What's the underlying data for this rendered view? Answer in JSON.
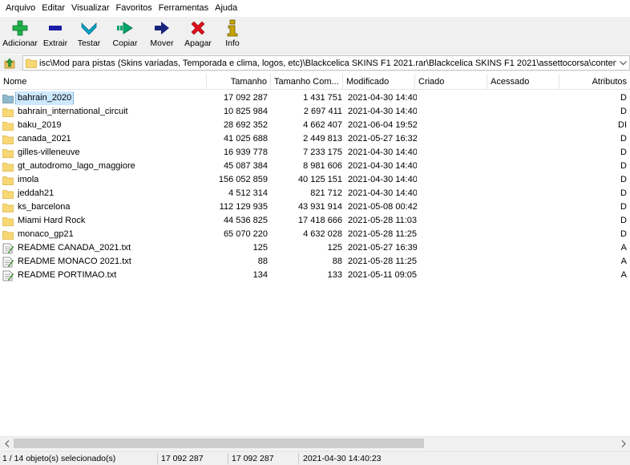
{
  "menu": [
    "Arquivo",
    "Editar",
    "Visualizar",
    "Favoritos",
    "Ferramentas",
    "Ajuda"
  ],
  "toolbar": [
    {
      "key": "add",
      "label": "Adicionar",
      "icon": "plus-icon",
      "color": "#22b14c"
    },
    {
      "key": "extract",
      "label": "Extrair",
      "icon": "minus-icon",
      "color": "#1a1aa6"
    },
    {
      "key": "test",
      "label": "Testar",
      "icon": "check-arrow-icon",
      "color": "#00a2c7"
    },
    {
      "key": "copy",
      "label": "Copiar",
      "icon": "double-arrow-icon",
      "color": "#00a86b"
    },
    {
      "key": "move",
      "label": "Mover",
      "icon": "arrow-right-icon",
      "color": "#1a237e"
    },
    {
      "key": "delete",
      "label": "Apagar",
      "icon": "x-icon",
      "color": "#e0101c"
    },
    {
      "key": "info",
      "label": "Info",
      "icon": "info-icon",
      "color": "#c8a400"
    }
  ],
  "address": {
    "path": "isc\\Mod para pistas (Skins variadas, Temporada e clima, logos, etc)\\Blackcelica SKINS F1 2021.rar\\Blackcelica SKINS F1 2021\\assettocorsa\\content\\tracks\\"
  },
  "columns": {
    "name": "Nome",
    "size": "Tamanho",
    "packed": "Tamanho Com...",
    "modified": "Modificado",
    "created": "Criado",
    "accessed": "Acessado",
    "attributes": "Atributos"
  },
  "rows": [
    {
      "name": "bahrain_2020",
      "type": "folder",
      "size": "17 092 287",
      "packed": "1 431 751",
      "modified": "2021-04-30 14:40",
      "attr": "D",
      "selected": true
    },
    {
      "name": "bahrain_international_circuit",
      "type": "folder",
      "size": "10 825 984",
      "packed": "2 697 411",
      "modified": "2021-04-30 14:40",
      "attr": "D"
    },
    {
      "name": "baku_2019",
      "type": "folder",
      "size": "28 692 352",
      "packed": "4 662 407",
      "modified": "2021-06-04 19:52",
      "attr": "DI"
    },
    {
      "name": "canada_2021",
      "type": "folder",
      "size": "41 025 688",
      "packed": "2 449 813",
      "modified": "2021-05-27 16:32",
      "attr": "D"
    },
    {
      "name": "gilles-villeneuve",
      "type": "folder",
      "size": "16 939 778",
      "packed": "7 233 175",
      "modified": "2021-04-30 14:40",
      "attr": "D"
    },
    {
      "name": "gt_autodromo_lago_maggiore",
      "type": "folder",
      "size": "45 087 384",
      "packed": "8 981 606",
      "modified": "2021-04-30 14:40",
      "attr": "D"
    },
    {
      "name": "imola",
      "type": "folder",
      "size": "156 052 859",
      "packed": "40 125 151",
      "modified": "2021-04-30 14:40",
      "attr": "D"
    },
    {
      "name": "jeddah21",
      "type": "folder",
      "size": "4 512 314",
      "packed": "821 712",
      "modified": "2021-04-30 14:40",
      "attr": "D"
    },
    {
      "name": "ks_barcelona",
      "type": "folder",
      "size": "112 129 935",
      "packed": "43 931 914",
      "modified": "2021-05-08 00:42",
      "attr": "D"
    },
    {
      "name": "Miami Hard Rock",
      "type": "folder",
      "size": "44 536 825",
      "packed": "17 418 666",
      "modified": "2021-05-28 11:03",
      "attr": "D"
    },
    {
      "name": "monaco_gp21",
      "type": "folder",
      "size": "65 070 220",
      "packed": "4 632 028",
      "modified": "2021-05-28 11:25",
      "attr": "D"
    },
    {
      "name": "README CANADA_2021.txt",
      "type": "txt",
      "size": "125",
      "packed": "125",
      "modified": "2021-05-27 16:39",
      "attr": "A"
    },
    {
      "name": "README MONACO 2021.txt",
      "type": "txt",
      "size": "88",
      "packed": "88",
      "modified": "2021-05-28 11:25",
      "attr": "A"
    },
    {
      "name": "README PORTIMAO.txt",
      "type": "txt",
      "size": "134",
      "packed": "133",
      "modified": "2021-05-11 09:05",
      "attr": "A"
    }
  ],
  "status": {
    "selection": "1 / 14 objeto(s) selecionado(s)",
    "size": "17 092 287",
    "packed": "17 092 287",
    "modified": "2021-04-30 14:40:23"
  }
}
